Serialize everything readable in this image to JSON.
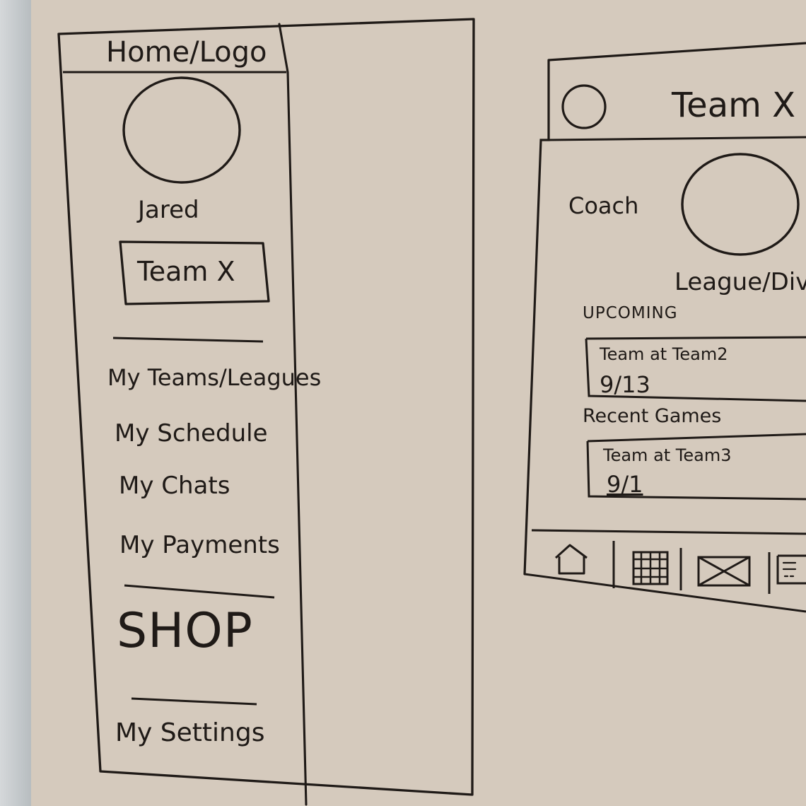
{
  "drawer": {
    "title": "Home/Logo",
    "user_name": "Jared",
    "team_button": "Team X",
    "menu": [
      "My Teams/Leagues",
      "My Schedule",
      "My Chats",
      "My Payments"
    ],
    "shop": "SHOP",
    "settings": "My Settings"
  },
  "team_screen": {
    "title": "Team X",
    "coach_label": "Coach",
    "league_label": "League/Div",
    "upcoming": {
      "section_title": "UPCOMING",
      "card_title": "Team at Team2",
      "card_date": "9/13"
    },
    "recent": {
      "section_title": "Recent Games",
      "card_title": "Team at Team3",
      "card_date": "9/1"
    },
    "bottom_tabs": [
      "home-icon",
      "calendar-icon",
      "mail-icon",
      "document-icon"
    ]
  }
}
